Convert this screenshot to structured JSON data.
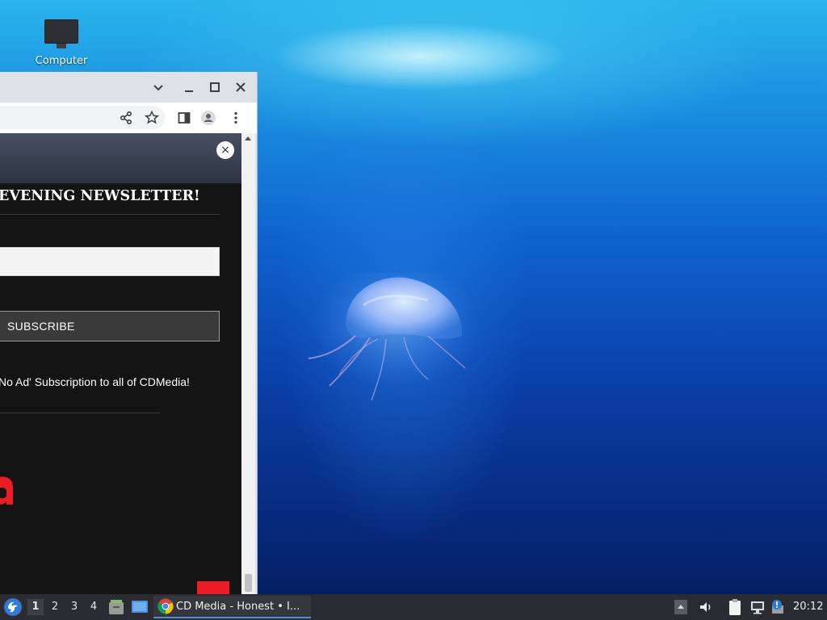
{
  "desktop": {
    "icons": [
      {
        "label": "Computer"
      }
    ]
  },
  "browser": {
    "window_buttons": [
      "tab-search",
      "minimize",
      "maximize",
      "close"
    ],
    "toolbar_icons": [
      "share-icon",
      "bookmark-star-icon",
      "side-panel-icon",
      "profile-icon",
      "menu-icon"
    ],
    "modal": {
      "close_symbol": "×",
      "heading": "EVENING NEWSLETTER!",
      "email_value": "",
      "subscribe_label": "SUBSCRIBE",
      "promo_text": "No Ad' Subscription to all of CDMedia!"
    },
    "colors": {
      "modal_background": "#141414",
      "modal_header": "#3b4252",
      "accent_red": "#ed1c24"
    }
  },
  "taskbar": {
    "workspaces": [
      "1",
      "2",
      "3",
      "4"
    ],
    "active_workspace": "1",
    "tasks": [
      {
        "label": "CD Media - Honest • I..."
      }
    ],
    "clock": "20:12"
  }
}
